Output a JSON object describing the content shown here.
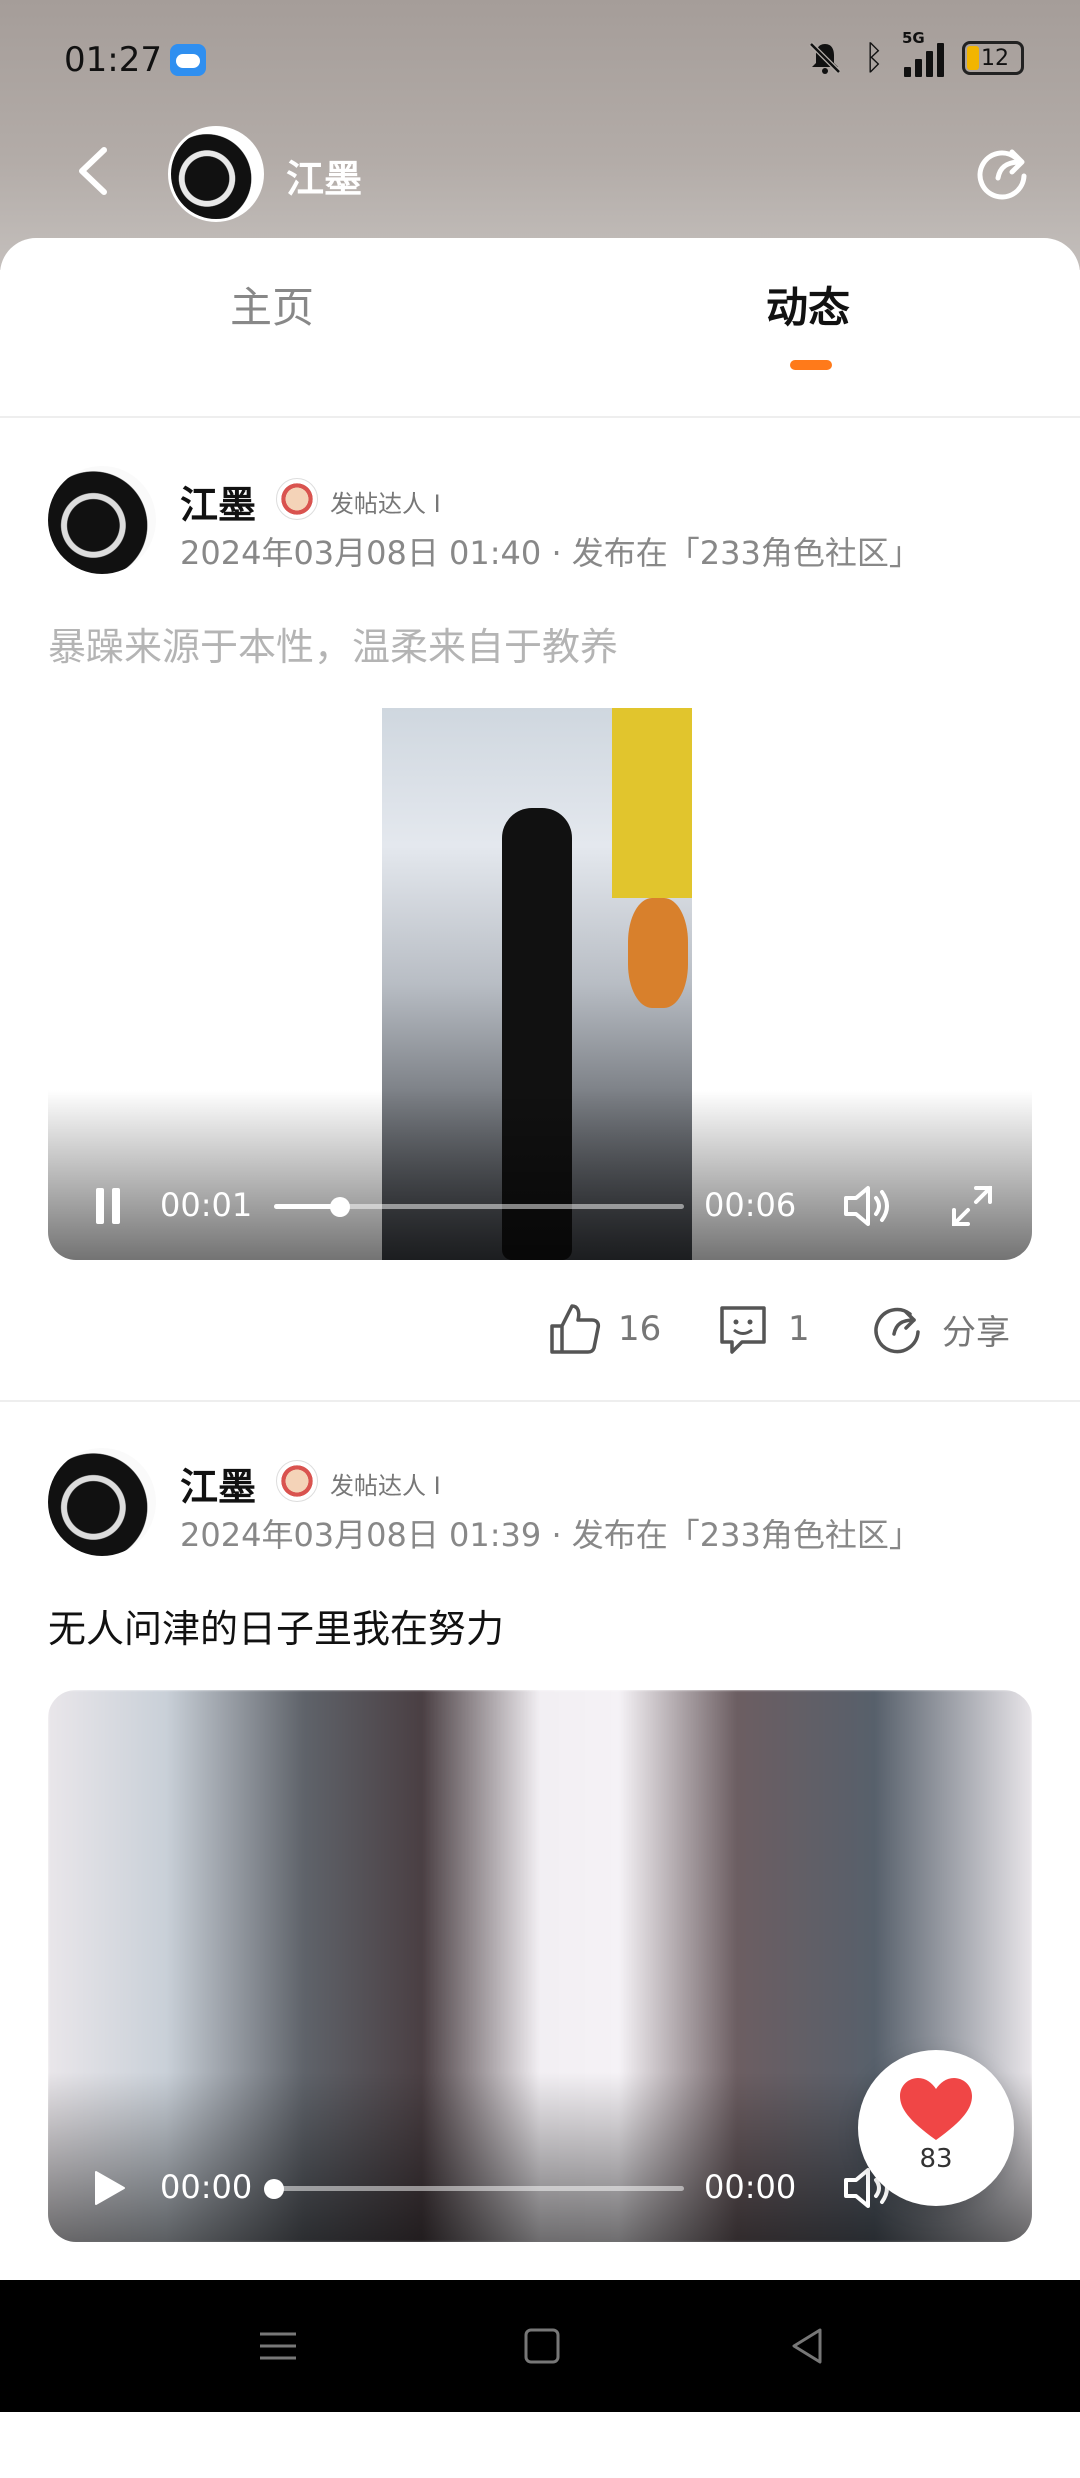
{
  "status_bar": {
    "time": "01:27",
    "network": "5G",
    "battery": "12"
  },
  "header": {
    "name": "江墨"
  },
  "tabs": {
    "home": "主页",
    "feed": "动态"
  },
  "posts": [
    {
      "author": "江墨",
      "badge": "发帖达人 I",
      "meta": "2024年03月08日 01:40 · 发布在「233角色社区」",
      "text": "暴躁来源于本性，温柔来自于教养",
      "video": {
        "current": "00:01",
        "total": "00:06",
        "progress": 0.16
      },
      "likes": "16",
      "comments": "1",
      "share": "分享"
    },
    {
      "author": "江墨",
      "badge": "发帖达人 I",
      "meta": "2024年03月08日 01:39 · 发布在「233角色社区」",
      "text": "无人问津的日子里我在努力",
      "video": {
        "current": "00:00",
        "total": "00:00",
        "progress": 0.0
      }
    }
  ],
  "like_fab": {
    "count": "83"
  },
  "colors": {
    "accent": "#ff7a1a",
    "heart": "#f04646"
  }
}
